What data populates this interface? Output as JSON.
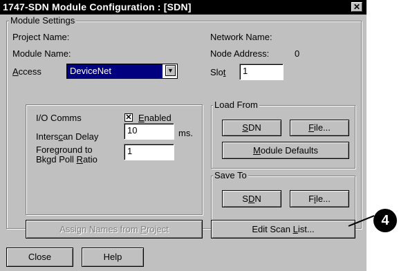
{
  "window": {
    "title": "1747-SDN Module Configuration : [SDN]",
    "close_glyph": "✕"
  },
  "module_settings": {
    "legend": "Module Settings",
    "project_name_label": "Project Name:",
    "module_name_label": "Module Name:",
    "access_label_prefix": "",
    "access_label_hot": "A",
    "access_label_rest": "ccess",
    "access_value": "DeviceNet",
    "network_name_label": "Network Name:",
    "node_address_label": "Node Address:",
    "node_address_value": "0",
    "slot_label_prefix": "Slo",
    "slot_label_hot": "t",
    "slot_value": "1"
  },
  "io": {
    "io_comms_label": "I/O Comms",
    "enabled_checked": true,
    "enabled_hot": "E",
    "enabled_rest": "nabled",
    "interscan_label_prefix": "Inters",
    "interscan_label_hot": "c",
    "interscan_label_rest": "an Delay",
    "interscan_value": "10",
    "interscan_unit": "ms.",
    "foreground_line1": "Foreground to",
    "foreground_line2_prefix": "Bkgd Poll ",
    "foreground_line2_hot": "R",
    "foreground_line2_rest": "atio",
    "foreground_value": "1"
  },
  "load_from": {
    "legend": "Load From",
    "sdn_hot": "S",
    "sdn_rest": "DN",
    "file_hot": "F",
    "file_rest": "ile...",
    "defaults_hot": "M",
    "defaults_rest": "odule Defaults"
  },
  "save_to": {
    "legend": "Save To",
    "sdn_prefix": "S",
    "sdn_hot": "D",
    "sdn_rest": "N",
    "file_prefix": "F",
    "file_hot": "i",
    "file_rest": "le..."
  },
  "buttons": {
    "assign_prefix": "Assign Names from ",
    "assign_hot": "P",
    "assign_rest": "roject",
    "scan_prefix": "Edit Scan ",
    "scan_hot": "L",
    "scan_rest": "ist...",
    "close": "Close",
    "help": "Help"
  },
  "callout": {
    "number": "4"
  }
}
